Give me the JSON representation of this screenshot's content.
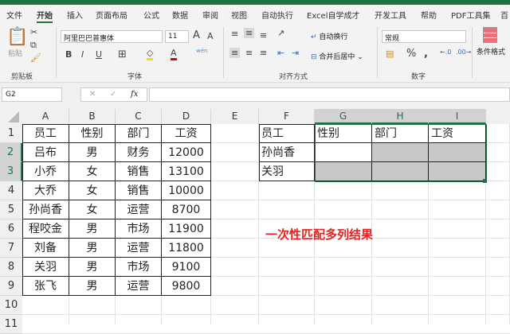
{
  "tabs": [
    "文件",
    "开始",
    "插入",
    "页面布局",
    "公式",
    "数据",
    "审阅",
    "视图",
    "自动执行",
    "Excel自学成才",
    "开发工具",
    "帮助",
    "PDF工具集",
    "百"
  ],
  "ribbon": {
    "paste": "粘贴",
    "clipboard": "剪贴板",
    "font_name": "阿里巴巴普惠体",
    "font_size": "11",
    "font_group": "字体",
    "wrap": "自动换行",
    "merge": "合并后居中",
    "align_group": "对齐方式",
    "number_format": "常规",
    "number_group": "数字",
    "cond_format": "条件格式",
    "wen": "wén"
  },
  "formula_bar": {
    "name_box": "G2",
    "fx": "fx",
    "value": ""
  },
  "columns": [
    "A",
    "B",
    "C",
    "D",
    "E",
    "F",
    "G",
    "H",
    "I"
  ],
  "rows": [
    "1",
    "2",
    "3",
    "4",
    "5",
    "6",
    "7",
    "8",
    "9",
    "10",
    "11"
  ],
  "table1": {
    "headers": [
      "员工",
      "性别",
      "部门",
      "工资"
    ],
    "rows": [
      [
        "吕布",
        "男",
        "财务",
        "12000"
      ],
      [
        "小乔",
        "女",
        "销售",
        "13100"
      ],
      [
        "大乔",
        "女",
        "销售",
        "10000"
      ],
      [
        "孙尚香",
        "女",
        "运营",
        "8700"
      ],
      [
        "程咬金",
        "男",
        "市场",
        "11900"
      ],
      [
        "刘备",
        "男",
        "运营",
        "11800"
      ],
      [
        "关羽",
        "男",
        "市场",
        "9100"
      ],
      [
        "张飞",
        "男",
        "运营",
        "9800"
      ]
    ]
  },
  "table2": {
    "headers": [
      "员工",
      "性别",
      "部门",
      "工资"
    ],
    "names": [
      "孙尚香",
      "关羽"
    ]
  },
  "annotation": "一次性匹配多列结果",
  "colors": {
    "accent": "#217346",
    "annotation": "#e8231f"
  }
}
